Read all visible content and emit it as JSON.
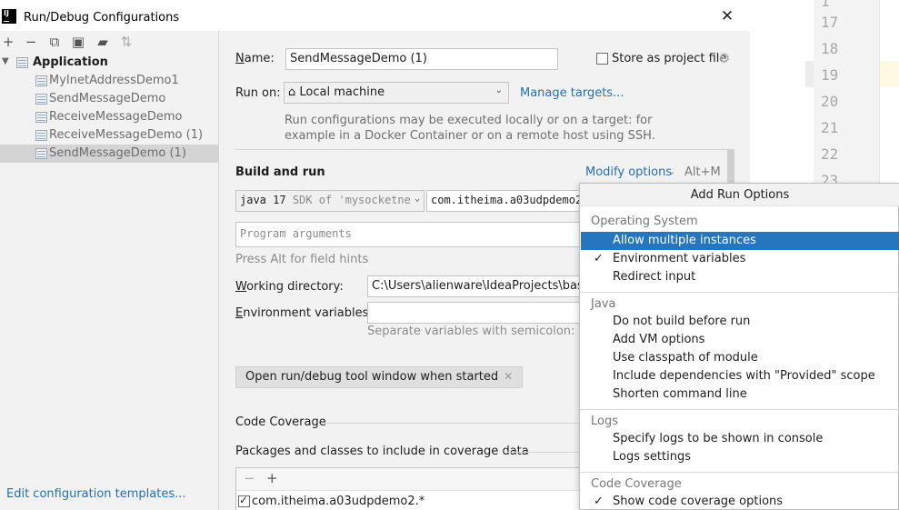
{
  "editor": {
    "line_numbers": [
      "17",
      "18",
      "19",
      "20",
      "21",
      "22",
      "23"
    ]
  },
  "dialog": {
    "title": "Run/Debug Configurations",
    "close_icon": "close-icon",
    "toolbar": [
      "add-icon",
      "remove-icon",
      "copy-icon",
      "save-icon",
      "new-folder-icon",
      "sort-icon"
    ]
  },
  "tree": {
    "group_label": "Application",
    "items": [
      {
        "label": "MyInetAddressDemo1"
      },
      {
        "label": "SendMessageDemo"
      },
      {
        "label": "ReceiveMessageDemo"
      },
      {
        "label": "ReceiveMessageDemo (1)"
      },
      {
        "label": "SendMessageDemo (1)"
      }
    ],
    "edit_templates_link": "Edit configuration templates..."
  },
  "form": {
    "name_label": "ame:",
    "name_label_first": "N",
    "name_value": "SendMessageDemo (1)",
    "store_label": "Store as project file",
    "run_on_label": "Run on:",
    "run_on_value": "Local machine",
    "manage_targets": "Manage targets...",
    "run_on_hint_1": "Run configurations may be executed locally or on a target: for",
    "run_on_hint_2": "example in a Docker Container or on a remote host using SSH.",
    "build_and_run": "Build and run",
    "modify_options": "Modify options",
    "modify_shortcut": "Alt+M",
    "sdk_java": "java 17",
    "sdk_rest": "SDK of 'mysocketne",
    "main_class": "com.itheima.a03udpdemo2",
    "program_args_placeholder": "Program arguments",
    "alt_hint": "Press Alt for field hints",
    "working_dir_label_first": "W",
    "working_dir_label": "orking directory:",
    "working_dir_value": "C:\\Users\\alienware\\IdeaProjects\\basic-",
    "env_label_first": "E",
    "env_label": "nvironment variables:",
    "env_value": "",
    "env_hint": "Separate variables with semicolon: VAR=",
    "tool_window_tag": "Open run/debug tool window when started",
    "code_coverage": "Code Coverage",
    "packages_label": "Packages and classes to include in coverage data",
    "coverage_pattern": "com.itheima.a03udpdemo2.*"
  },
  "popup": {
    "title": "Add Run Options",
    "groups": {
      "os": "Operating System",
      "java": "Java",
      "logs": "Logs",
      "coverage": "Code Coverage"
    },
    "os_items": [
      {
        "label": "Allow multiple instances",
        "checked": false
      },
      {
        "label": "Environment variables",
        "checked": true
      },
      {
        "label": "Redirect input",
        "checked": false
      }
    ],
    "java_items": [
      {
        "label": "Do not build before run"
      },
      {
        "label": "Add VM options"
      },
      {
        "label": "Use classpath of module"
      },
      {
        "label": "Include dependencies with \"Provided\" scope"
      },
      {
        "label": "Shorten command line"
      }
    ],
    "logs_items": [
      {
        "label": "Specify logs to be shown in console"
      },
      {
        "label": "Logs settings"
      }
    ],
    "coverage_items": [
      {
        "label": "Show code coverage options",
        "checked": true
      }
    ],
    "check_mark": "✓"
  },
  "colors": {
    "accent": "#2675bf",
    "link": "#2470b3",
    "selection": "#d4d4d4"
  }
}
